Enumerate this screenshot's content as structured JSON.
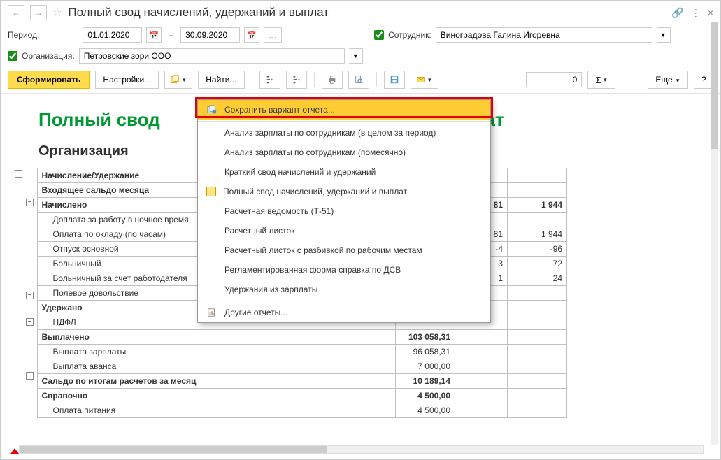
{
  "title": "Полный свод начислений, удержаний и выплат",
  "filters": {
    "period_label": "Период:",
    "date_from": "01.01.2020",
    "date_to": "30.09.2020",
    "employee_label": "Сотрудник:",
    "employee_value": "Виноградова Галина Игоревна",
    "org_label": "Организация:",
    "org_value": "Петровские зори ООО"
  },
  "toolbar": {
    "generate": "Сформировать",
    "settings": "Настройки...",
    "find": "Найти...",
    "more": "Еще",
    "num_value": "0"
  },
  "menu": {
    "save_variant": "Сохранить вариант отчета...",
    "items": [
      "Анализ зарплаты по сотрудникам (в целом за период)",
      "Анализ зарплаты по сотрудникам (помесячно)",
      "Краткий свод начислений и удержаний",
      "Полный свод начислений, удержаний и выплат",
      "Расчетная ведомость (Т-51)",
      "Расчетный листок",
      "Расчетный листок с разбивкой по рабочим местам",
      "Регламентированная форма справка по ДСВ",
      "Удержания из зарплаты"
    ],
    "selected_index": 3,
    "other": "Другие отчеты..."
  },
  "report": {
    "title_visible": "Полный свод",
    "title_tail": "плат",
    "org_heading": "Организация",
    "header_col1": "Начисление/Удержание",
    "rows": [
      {
        "label": "Входящее сальдо месяца",
        "bold": true,
        "v1": "",
        "v2": "",
        "v3": ""
      },
      {
        "label": "Начислено",
        "bold": true,
        "v1": "",
        "v2": "81",
        "v3": "1 944"
      },
      {
        "label": "Доплата за работу в ночное время",
        "indent": true,
        "v1": "",
        "v2": "",
        "v3": ""
      },
      {
        "label": "Оплата по окладу (по часам)",
        "indent": true,
        "v1": "",
        "v2": "81",
        "v3": "1 944"
      },
      {
        "label": "Отпуск основной",
        "indent": true,
        "v1": "",
        "v2": "-4",
        "v3": "-96"
      },
      {
        "label": "Больничный",
        "indent": true,
        "v1": "",
        "v2": "3",
        "v3": "72"
      },
      {
        "label": "Больничный за счет работодателя",
        "indent": true,
        "v1": "",
        "v2": "1",
        "v3": "24"
      },
      {
        "label": "Полевое довольствие",
        "indent": true,
        "v1": "",
        "v2": "",
        "v3": ""
      },
      {
        "label": "Удержано",
        "bold": true,
        "v1": "",
        "v2": "",
        "v3": ""
      },
      {
        "label": "НДФЛ",
        "indent": true,
        "v1": "",
        "v2": "",
        "v3": ""
      },
      {
        "label": "Выплачено",
        "bold": true,
        "v1": "103 058,31",
        "v2": "",
        "v3": ""
      },
      {
        "label": "Выплата зарплаты",
        "indent": true,
        "v1": "96 058,31",
        "v2": "",
        "v3": ""
      },
      {
        "label": "Выплата аванса",
        "indent": true,
        "v1": "7 000,00",
        "v2": "",
        "v3": ""
      },
      {
        "label": "Сальдо по итогам расчетов за месяц",
        "bold": true,
        "v1": "10 189,14",
        "v2": "",
        "v3": ""
      },
      {
        "label": "Справочно",
        "bold": true,
        "v1": "4 500,00",
        "v2": "",
        "v3": ""
      },
      {
        "label": "Оплата питания",
        "indent": true,
        "v1": "4 500,00",
        "v2": "",
        "v3": ""
      }
    ]
  }
}
